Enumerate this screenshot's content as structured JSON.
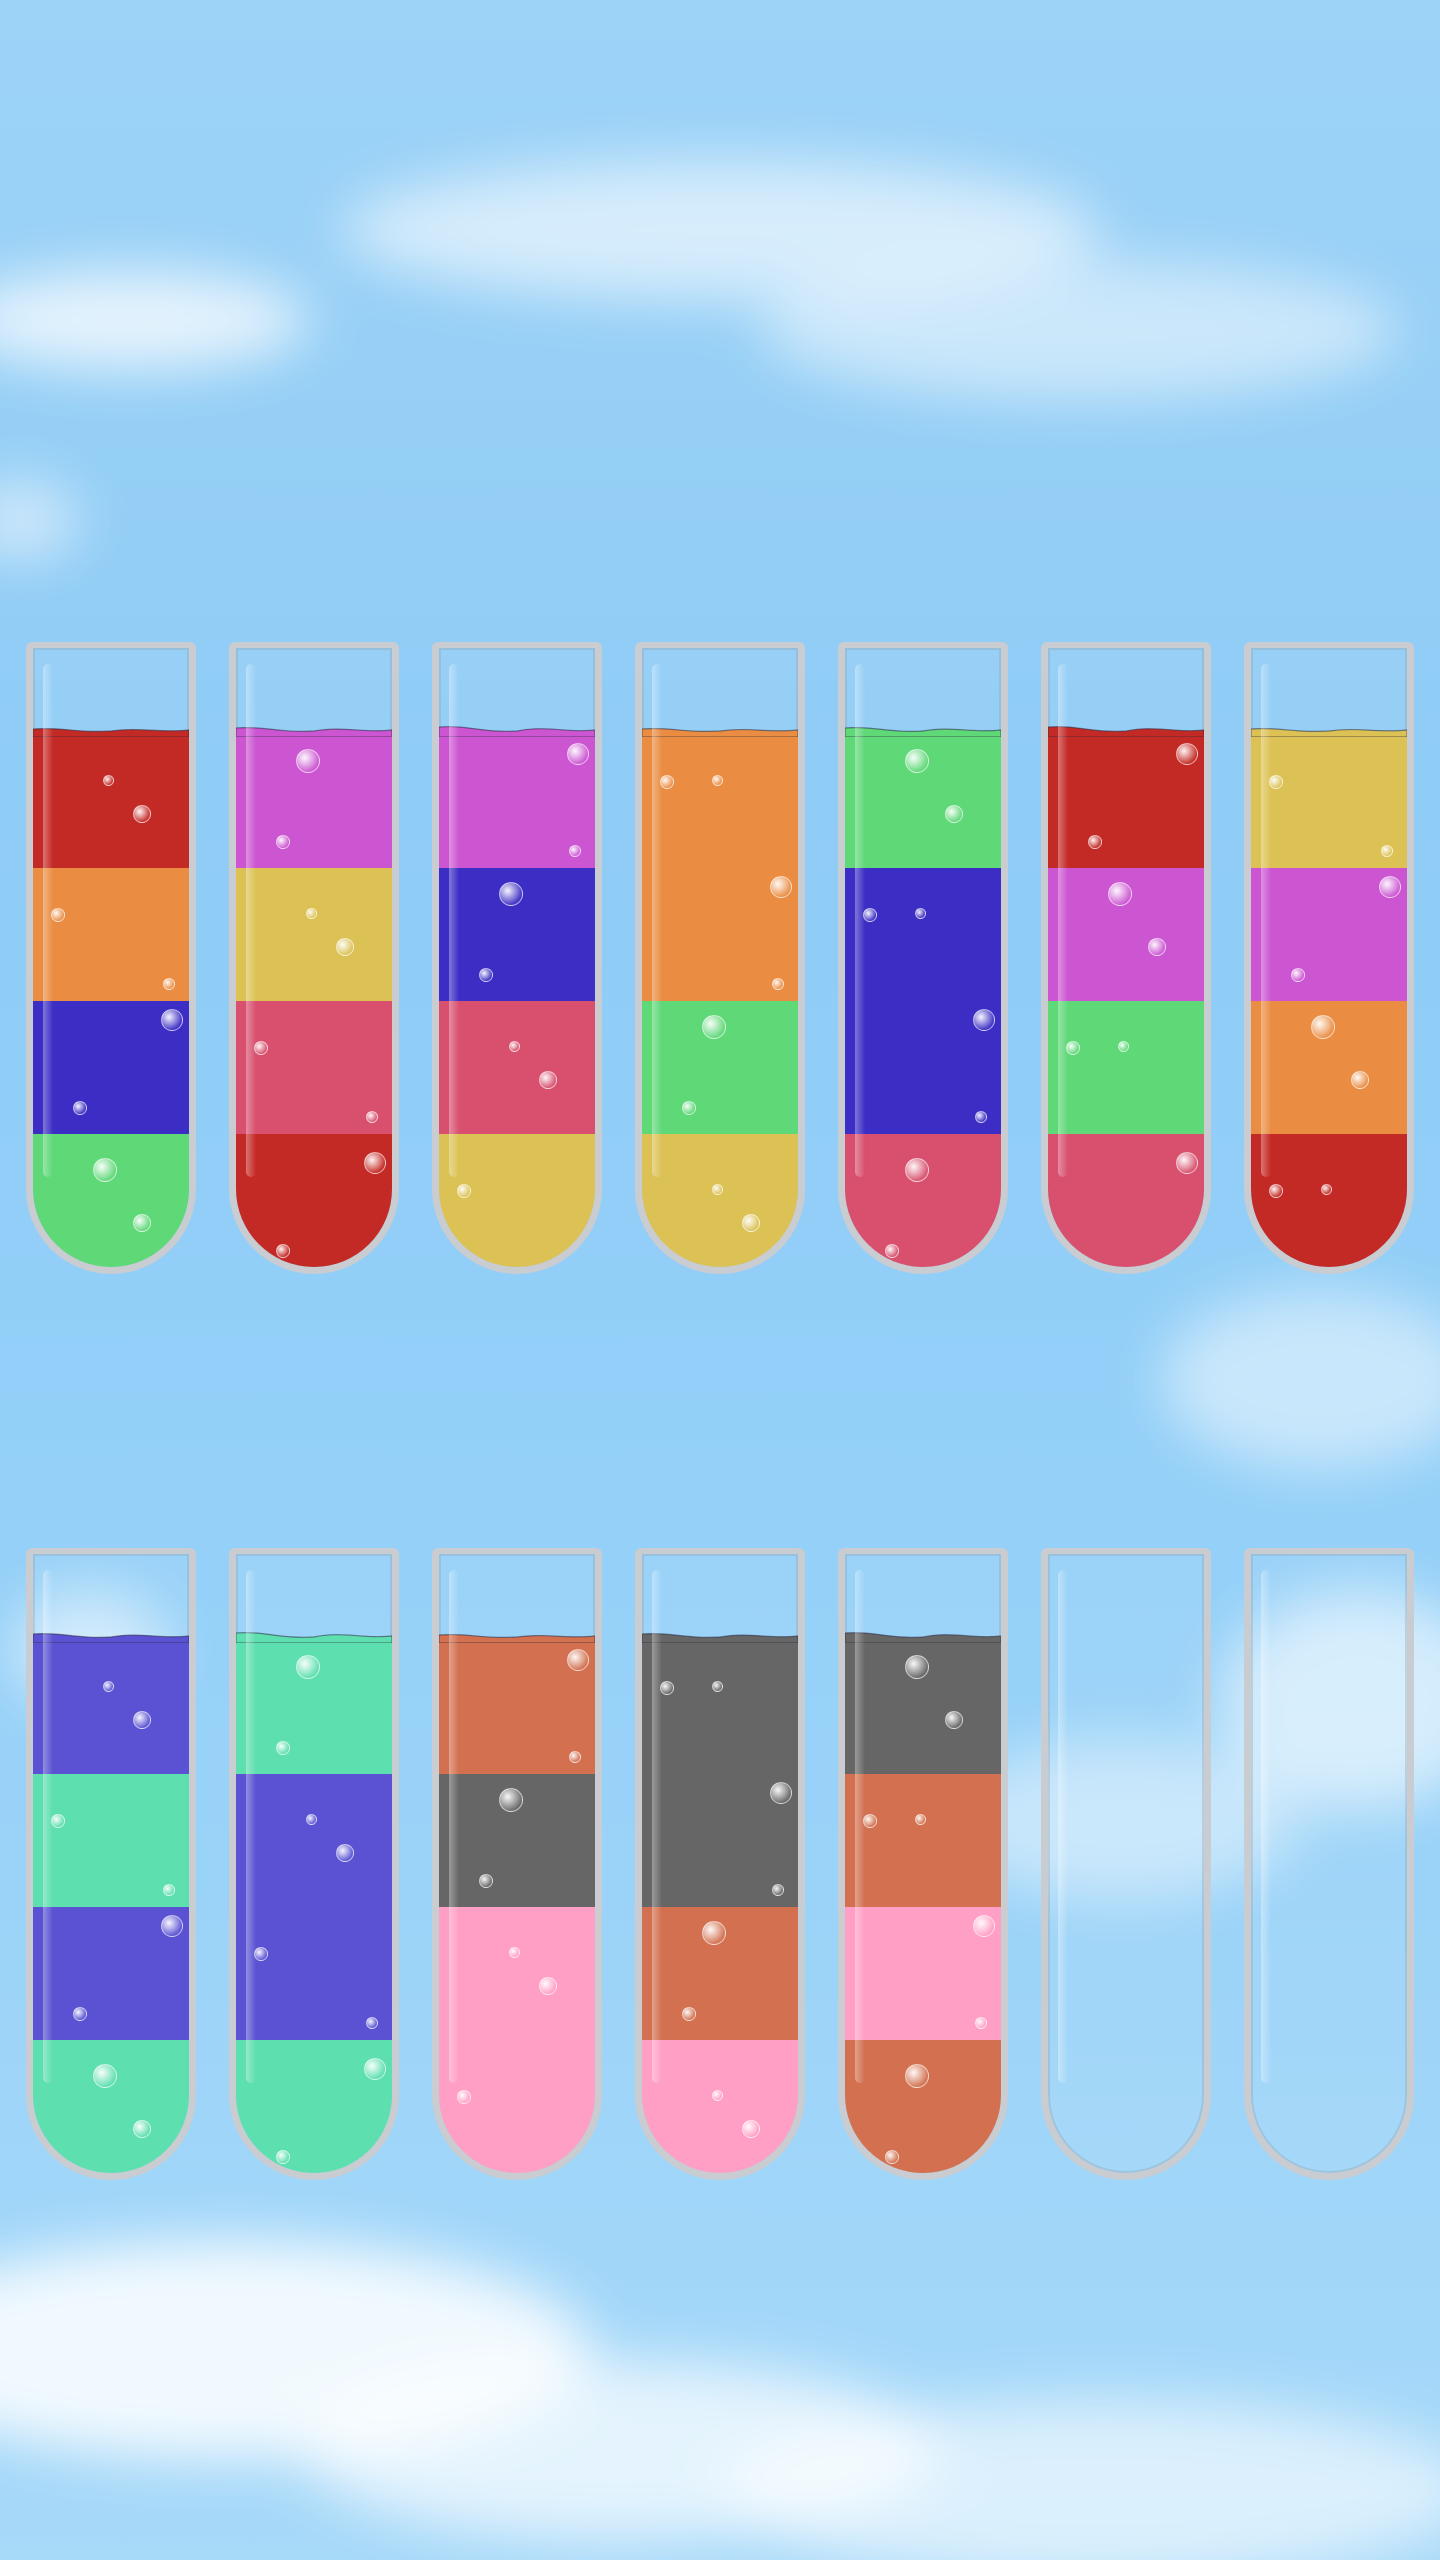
{
  "colors": {
    "red": "#c42a25",
    "orange": "#ea8d43",
    "blue": "#3c2ec4",
    "green": "#5fd878",
    "magenta": "#cc55d2",
    "yellow": "#dcc255",
    "pink_red": "#d8506e",
    "violet": "#5a52d3",
    "mint": "#5ddfaf",
    "terracotta": "#d2704f",
    "gray": "#666666",
    "light_pink": "#ff9fc5"
  },
  "tubes": [
    {
      "row": 0,
      "layers": [
        "green",
        "blue",
        "orange",
        "red"
      ]
    },
    {
      "row": 0,
      "layers": [
        "red",
        "pink_red",
        "yellow",
        "magenta"
      ]
    },
    {
      "row": 0,
      "layers": [
        "yellow",
        "pink_red",
        "blue",
        "magenta"
      ]
    },
    {
      "row": 0,
      "layers": [
        "yellow",
        "green",
        "orange",
        "orange"
      ]
    },
    {
      "row": 0,
      "layers": [
        "pink_red",
        "blue",
        "blue",
        "green"
      ]
    },
    {
      "row": 0,
      "layers": [
        "pink_red",
        "green",
        "magenta",
        "red"
      ]
    },
    {
      "row": 0,
      "layers": [
        "red",
        "orange",
        "magenta",
        "yellow"
      ]
    },
    {
      "row": 1,
      "layers": [
        "mint",
        "violet",
        "mint",
        "violet"
      ]
    },
    {
      "row": 1,
      "layers": [
        "mint",
        "violet",
        "violet",
        "mint"
      ]
    },
    {
      "row": 1,
      "layers": [
        "light_pink",
        "light_pink",
        "gray",
        "terracotta"
      ]
    },
    {
      "row": 1,
      "layers": [
        "light_pink",
        "terracotta",
        "gray",
        "gray"
      ]
    },
    {
      "row": 1,
      "layers": [
        "terracotta",
        "light_pink",
        "terracotta",
        "gray"
      ]
    },
    {
      "row": 1,
      "layers": []
    },
    {
      "row": 1,
      "layers": []
    }
  ]
}
